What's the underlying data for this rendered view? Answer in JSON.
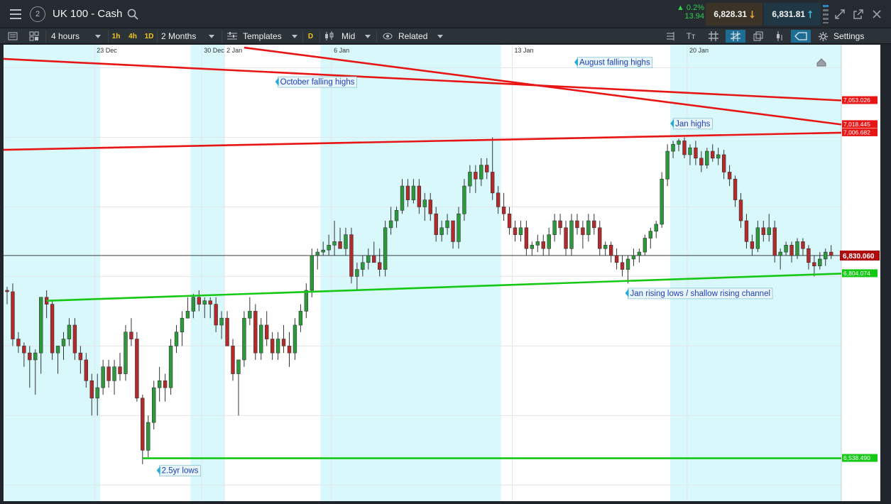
{
  "header": {
    "instrument": "UK 100 - Cash",
    "layout_number": "2",
    "change_pct": "0.2%",
    "change_points": "13.94",
    "sell_price": "6,828.31",
    "buy_price": "6,831.81"
  },
  "toolbar": {
    "interval": "4 hours",
    "quick_intervals": [
      "1h",
      "4h",
      "1D"
    ],
    "range": "2 Months",
    "templates": "Templates",
    "d_tag": "D",
    "price_mode": "Mid",
    "related": "Related",
    "settings": "Settings"
  },
  "colors": {
    "up": "#2c9a3c",
    "down": "#b4292a",
    "resistance": "#e81515",
    "support": "#14c814",
    "shade": "#d8f8fc",
    "annotation_bg": "#e9f6f9",
    "annotation_text": "#1f3fb8"
  },
  "chart_data": {
    "type": "candlestick",
    "ylim": [
      6485,
      7125
    ],
    "y_ticks": [
      "6,500.000",
      "6,600.000",
      "6,700.000",
      "6,800.000",
      "6,900.000",
      "7,000.000",
      "7,100.000"
    ],
    "x_ticks": [
      {
        "label": "23 Dec",
        "i": 16
      },
      {
        "label": "30 Dec",
        "i": 35
      },
      {
        "label": "2 Jan",
        "i": 39
      },
      {
        "label": "6 Jan",
        "i": 58
      },
      {
        "label": "13 Jan",
        "i": 90
      },
      {
        "label": "20 Jan",
        "i": 121
      }
    ],
    "shaded_ranges": [
      [
        0,
        16
      ],
      [
        33,
        38
      ],
      [
        56,
        87
      ],
      [
        118,
        148
      ]
    ],
    "current_price": {
      "value": 6830.06,
      "label": "6,830.060"
    },
    "trendlines": [
      {
        "kind": "resistance",
        "from": [
          -1,
          7113
        ],
        "to": [
          150,
          7053.026
        ],
        "label": "7,053.026"
      },
      {
        "kind": "resistance",
        "from": [
          42,
          7129
        ],
        "to": [
          150,
          7018.445
        ],
        "label": "7,018.445"
      },
      {
        "kind": "resistance",
        "from": [
          -1,
          6982
        ],
        "to": [
          150,
          7006.682
        ],
        "label": "7,006.682"
      },
      {
        "kind": "support",
        "from": [
          7,
          6765
        ],
        "to": [
          150,
          6804.074
        ],
        "label": "6,804.074"
      },
      {
        "kind": "support",
        "from": [
          24,
          6538.49
        ],
        "to": [
          150,
          6538.49
        ],
        "label": "6,538.490"
      }
    ],
    "annotations": [
      {
        "text": "August falling highs",
        "i": 100.5,
        "y": 7108
      },
      {
        "text": "October falling highs",
        "i": 47.5,
        "y": 7080
      },
      {
        "text": "Jan highs",
        "i": 117.5,
        "y": 7020
      },
      {
        "text": "Jan rising lows / shallow rising channel",
        "i": 109.5,
        "y": 6776
      },
      {
        "text": "2.5yr lows",
        "i": 26.5,
        "y": 6521
      }
    ],
    "candles": [
      [
        6780,
        6785,
        6760,
        6778
      ],
      [
        6778,
        6790,
        6700,
        6710
      ],
      [
        6710,
        6720,
        6690,
        6700
      ],
      [
        6700,
        6705,
        6670,
        6690
      ],
      [
        6690,
        6700,
        6640,
        6680
      ],
      [
        6680,
        6695,
        6630,
        6690
      ],
      [
        6690,
        6770,
        6660,
        6770
      ],
      [
        6770,
        6780,
        6740,
        6760
      ],
      [
        6760,
        6765,
        6680,
        6690
      ],
      [
        6690,
        6700,
        6660,
        6700
      ],
      [
        6700,
        6720,
        6680,
        6710
      ],
      [
        6710,
        6740,
        6700,
        6730
      ],
      [
        6730,
        6740,
        6680,
        6690
      ],
      [
        6690,
        6700,
        6660,
        6680
      ],
      [
        6680,
        6690,
        6640,
        6650
      ],
      [
        6650,
        6660,
        6600,
        6625
      ],
      [
        6625,
        6660,
        6600,
        6640
      ],
      [
        6640,
        6680,
        6630,
        6670
      ],
      [
        6670,
        6680,
        6640,
        6650
      ],
      [
        6650,
        6680,
        6630,
        6670
      ],
      [
        6670,
        6690,
        6650,
        6660
      ],
      [
        6660,
        6730,
        6650,
        6720
      ],
      [
        6720,
        6740,
        6700,
        6710
      ],
      [
        6710,
        6720,
        6620,
        6625
      ],
      [
        6625,
        6630,
        6530,
        6550
      ],
      [
        6550,
        6600,
        6540,
        6590
      ],
      [
        6590,
        6650,
        6580,
        6640
      ],
      [
        6640,
        6670,
        6620,
        6650
      ],
      [
        6650,
        6660,
        6620,
        6640
      ],
      [
        6640,
        6710,
        6630,
        6700
      ],
      [
        6700,
        6730,
        6690,
        6720
      ],
      [
        6720,
        6750,
        6700,
        6740
      ],
      [
        6740,
        6770,
        6740,
        6750
      ],
      [
        6750,
        6775,
        6740,
        6770
      ],
      [
        6770,
        6780,
        6750,
        6760
      ],
      [
        6760,
        6770,
        6740,
        6765
      ],
      [
        6765,
        6770,
        6740,
        6760
      ],
      [
        6760,
        6770,
        6720,
        6730
      ],
      [
        6730,
        6750,
        6710,
        6740
      ],
      [
        6740,
        6750,
        6700,
        6700
      ],
      [
        6700,
        6710,
        6650,
        6660
      ],
      [
        6660,
        6680,
        6600,
        6680
      ],
      [
        6680,
        6750,
        6670,
        6740
      ],
      [
        6740,
        6770,
        6730,
        6750
      ],
      [
        6750,
        6760,
        6680,
        6690
      ],
      [
        6690,
        6740,
        6680,
        6730
      ],
      [
        6730,
        6750,
        6700,
        6710
      ],
      [
        6710,
        6720,
        6680,
        6690
      ],
      [
        6690,
        6720,
        6680,
        6710
      ],
      [
        6710,
        6730,
        6690,
        6700
      ],
      [
        6700,
        6720,
        6670,
        6690
      ],
      [
        6690,
        6740,
        6680,
        6730
      ],
      [
        6730,
        6760,
        6720,
        6750
      ],
      [
        6750,
        6790,
        6740,
        6780
      ],
      [
        6780,
        6840,
        6770,
        6830
      ],
      [
        6830,
        6840,
        6810,
        6835
      ],
      [
        6835,
        6850,
        6830,
        6838
      ],
      [
        6838,
        6860,
        6830,
        6845
      ],
      [
        6845,
        6880,
        6830,
        6850
      ],
      [
        6850,
        6870,
        6840,
        6840
      ],
      [
        6840,
        6870,
        6830,
        6860
      ],
      [
        6860,
        6870,
        6790,
        6800
      ],
      [
        6800,
        6820,
        6780,
        6810
      ],
      [
        6810,
        6830,
        6800,
        6820
      ],
      [
        6820,
        6840,
        6810,
        6830
      ],
      [
        6830,
        6850,
        6820,
        6820
      ],
      [
        6820,
        6840,
        6800,
        6810
      ],
      [
        6810,
        6880,
        6800,
        6870
      ],
      [
        6870,
        6900,
        6860,
        6880
      ],
      [
        6880,
        6900,
        6870,
        6895
      ],
      [
        6895,
        6940,
        6890,
        6930
      ],
      [
        6930,
        6940,
        6900,
        6910
      ],
      [
        6910,
        6940,
        6905,
        6930
      ],
      [
        6930,
        6940,
        6890,
        6900
      ],
      [
        6900,
        6920,
        6880,
        6910
      ],
      [
        6910,
        6920,
        6880,
        6890
      ],
      [
        6890,
        6900,
        6850,
        6860
      ],
      [
        6860,
        6880,
        6850,
        6870
      ],
      [
        6870,
        6890,
        6860,
        6880
      ],
      [
        6880,
        6880,
        6840,
        6850
      ],
      [
        6850,
        6900,
        6840,
        6890
      ],
      [
        6890,
        6940,
        6880,
        6930
      ],
      [
        6930,
        6960,
        6920,
        6950
      ],
      [
        6950,
        6960,
        6920,
        6940
      ],
      [
        6940,
        6970,
        6930,
        6960
      ],
      [
        6960,
        6970,
        6940,
        6950
      ],
      [
        6950,
        7000,
        6910,
        6920
      ],
      [
        6920,
        6930,
        6890,
        6900
      ],
      [
        6900,
        6920,
        6880,
        6890
      ],
      [
        6890,
        6900,
        6860,
        6870
      ],
      [
        6870,
        6880,
        6850,
        6860
      ],
      [
        6860,
        6880,
        6850,
        6870
      ],
      [
        6870,
        6880,
        6830,
        6840
      ],
      [
        6840,
        6850,
        6830,
        6845
      ],
      [
        6845,
        6860,
        6835,
        6850
      ],
      [
        6850,
        6860,
        6830,
        6840
      ],
      [
        6840,
        6870,
        6830,
        6860
      ],
      [
        6860,
        6890,
        6850,
        6880
      ],
      [
        6880,
        6890,
        6860,
        6870
      ],
      [
        6870,
        6880,
        6830,
        6840
      ],
      [
        6840,
        6890,
        6830,
        6880
      ],
      [
        6880,
        6890,
        6860,
        6870
      ],
      [
        6870,
        6880,
        6840,
        6860
      ],
      [
        6860,
        6890,
        6850,
        6880
      ],
      [
        6880,
        6890,
        6860,
        6870
      ],
      [
        6870,
        6880,
        6830,
        6840
      ],
      [
        6840,
        6850,
        6830,
        6845
      ],
      [
        6845,
        6850,
        6820,
        6830
      ],
      [
        6830,
        6840,
        6810,
        6820
      ],
      [
        6820,
        6830,
        6800,
        6810
      ],
      [
        6810,
        6830,
        6790,
        6825
      ],
      [
        6825,
        6840,
        6815,
        6830
      ],
      [
        6830,
        6840,
        6820,
        6835
      ],
      [
        6835,
        6860,
        6830,
        6855
      ],
      [
        6855,
        6870,
        6840,
        6865
      ],
      [
        6865,
        6880,
        6855,
        6875
      ],
      [
        6875,
        6950,
        6870,
        6940
      ],
      [
        6940,
        6990,
        6930,
        6980
      ],
      [
        6980,
        6995,
        6970,
        6990
      ],
      [
        6990,
        6998,
        6980,
        6995
      ],
      [
        6995,
        7000,
        6970,
        6975
      ],
      [
        6975,
        6990,
        6960,
        6985
      ],
      [
        6985,
        6995,
        6960,
        6970
      ],
      [
        6970,
        6980,
        6950,
        6960
      ],
      [
        6960,
        6985,
        6955,
        6980
      ],
      [
        6980,
        6990,
        6965,
        6970
      ],
      [
        6970,
        6985,
        6960,
        6975
      ],
      [
        6975,
        6982,
        6940,
        6950
      ],
      [
        6950,
        6960,
        6930,
        6940
      ],
      [
        6940,
        6945,
        6900,
        6910
      ],
      [
        6910,
        6920,
        6870,
        6880
      ],
      [
        6880,
        6890,
        6840,
        6850
      ],
      [
        6850,
        6860,
        6830,
        6840
      ],
      [
        6840,
        6880,
        6835,
        6870
      ],
      [
        6870,
        6880,
        6850,
        6860
      ],
      [
        6860,
        6890,
        6850,
        6870
      ],
      [
        6870,
        6880,
        6820,
        6830
      ],
      [
        6830,
        6840,
        6810,
        6835
      ],
      [
        6835,
        6850,
        6830,
        6845
      ],
      [
        6845,
        6850,
        6820,
        6830
      ],
      [
        6830,
        6855,
        6825,
        6850
      ],
      [
        6850,
        6855,
        6830,
        6840
      ],
      [
        6840,
        6845,
        6810,
        6820
      ],
      [
        6820,
        6830,
        6800,
        6815
      ],
      [
        6815,
        6835,
        6810,
        6825
      ],
      [
        6825,
        6840,
        6815,
        6835
      ],
      [
        6835,
        6845,
        6825,
        6830
      ]
    ]
  }
}
